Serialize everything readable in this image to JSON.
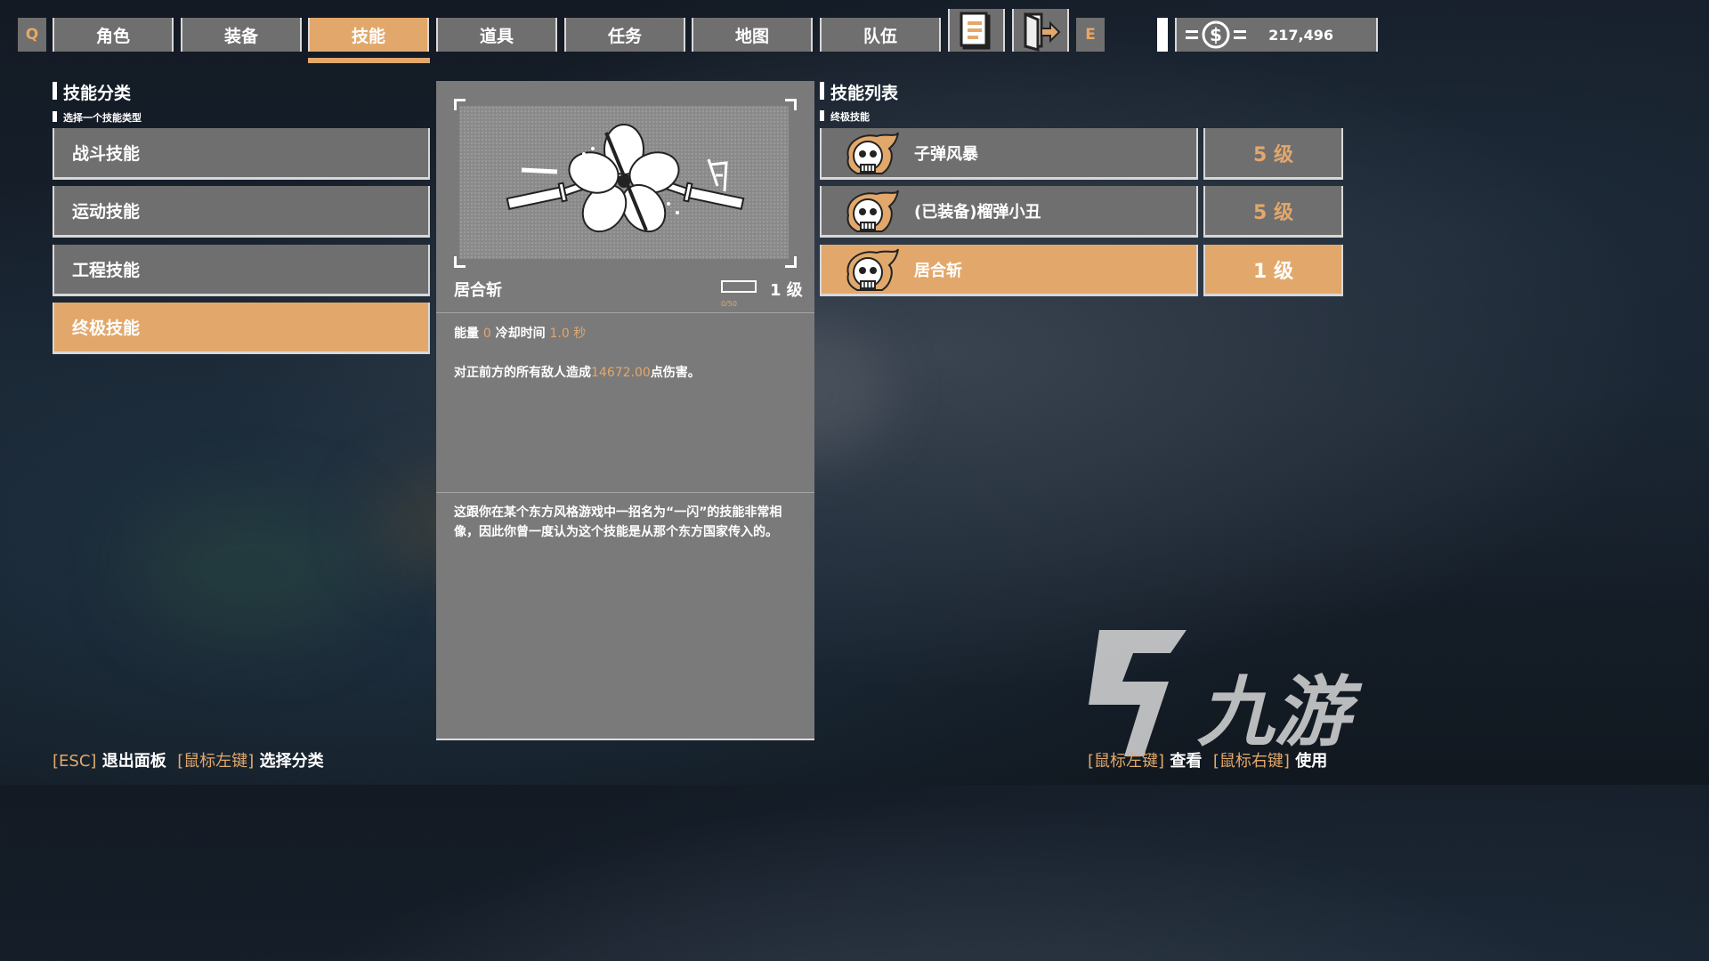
{
  "nav": {
    "left_key": "Q",
    "right_key": "E",
    "tabs": [
      "角色",
      "装备",
      "技能",
      "道具",
      "任务",
      "地图",
      "队伍"
    ],
    "active_tab": "技能",
    "icons": [
      "journal-icon",
      "exit-door-icon"
    ]
  },
  "money": {
    "icon": "dollar-icon",
    "amount": "217,496"
  },
  "categories": {
    "title": "技能分类",
    "subtitle": "选择一个技能类型",
    "items": [
      "战斗技能",
      "运动技能",
      "工程技能",
      "终极技能"
    ],
    "active": "终极技能"
  },
  "detail": {
    "image_icon": "iai-slash-emblem-icon",
    "name": "居合斩",
    "xp": "0/50",
    "xp_fraction": 0,
    "level": "1 级",
    "energy_label": "能量",
    "energy_value": "0",
    "cooldown_label": "冷却时间",
    "cooldown_value": "1.0 秒",
    "effect_prefix": "对正前方的所有敌人造成",
    "effect_value": "14672.00",
    "effect_suffix": "点伤害。",
    "flavor": "这跟你在某个东方风格游戏中一招名为“一闪”的技能非常相像，因此你曾一度认为这个技能是从那个东方国家传入的。"
  },
  "skills": {
    "title": "技能列表",
    "subtitle": "终极技能",
    "items": [
      {
        "name": "子弹风暴",
        "level": "5 级",
        "icon": "flaming-skull-icon"
      },
      {
        "name": "(已装备)榴弹小丑",
        "level": "5 级",
        "icon": "flaming-skull-icon"
      },
      {
        "name": "居合斩",
        "level": "1 级",
        "icon": "flaming-skull-icon"
      }
    ],
    "active": "居合斩"
  },
  "footer": {
    "left": [
      {
        "key": "[ESC]",
        "action": "退出面板"
      },
      {
        "key": "[鼠标左键]",
        "action": "选择分类"
      }
    ],
    "right": [
      {
        "key": "[鼠标左键]",
        "action": "查看"
      },
      {
        "key": "[鼠标右键]",
        "action": "使用"
      }
    ]
  },
  "watermark": {
    "text": "九游"
  },
  "colors": {
    "accent": "#e2a86b",
    "panel": "#6f6f6f",
    "detail_panel": "#7a7a7a"
  }
}
